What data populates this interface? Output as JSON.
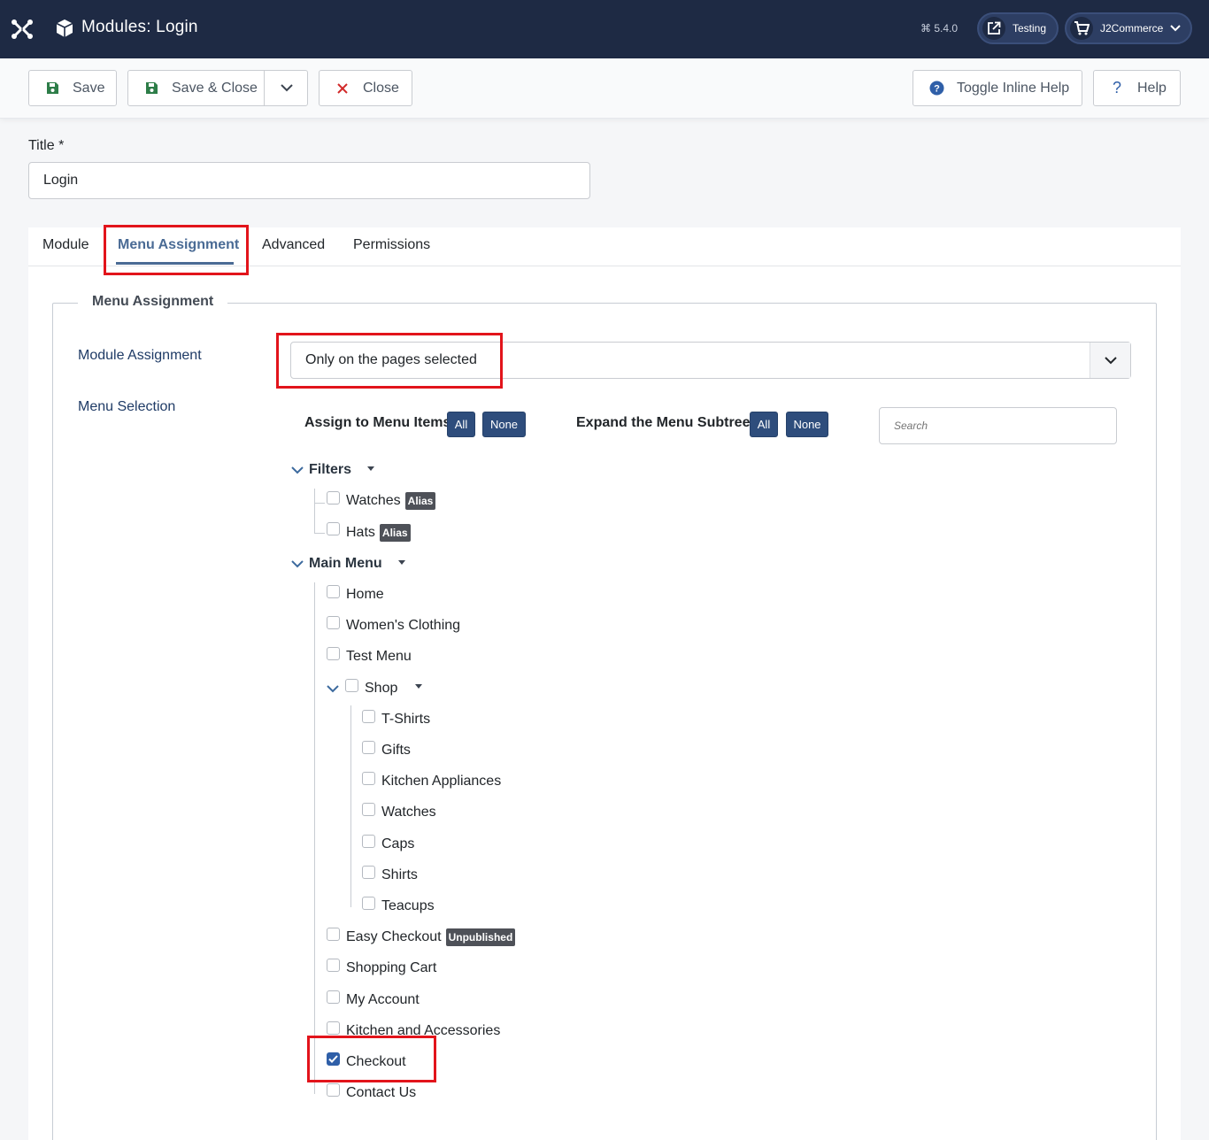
{
  "header": {
    "title": "Modules: Login",
    "version": "5.4.0",
    "site_button": "Testing",
    "user_button": "J2Commerce"
  },
  "toolbar": {
    "save": "Save",
    "save_close": "Save & Close",
    "close": "Close",
    "toggle_help": "Toggle Inline Help",
    "help": "Help"
  },
  "form": {
    "title_label": "Title *",
    "title_value": "Login"
  },
  "tabs": {
    "module": "Module",
    "menu_assignment": "Menu Assignment",
    "advanced": "Advanced",
    "permissions": "Permissions"
  },
  "menu_assignment": {
    "legend": "Menu Assignment",
    "module_assignment_label": "Module Assignment",
    "module_assignment_value": "Only on the pages selected",
    "menu_selection_label": "Menu Selection",
    "assign_label": "Assign to Menu Items",
    "expand_label": "Expand the Menu Subtrees",
    "all": "All",
    "none": "None",
    "search_placeholder": "Search"
  },
  "tree": {
    "filters": {
      "label": "Filters",
      "items": [
        {
          "label": "Watches",
          "badge": "Alias",
          "checked": false
        },
        {
          "label": "Hats",
          "badge": "Alias",
          "checked": false
        }
      ]
    },
    "main_menu": {
      "label": "Main Menu",
      "items": [
        {
          "label": "Home",
          "checked": false
        },
        {
          "label": "Women's Clothing",
          "checked": false
        },
        {
          "label": "Test Menu",
          "checked": false
        },
        {
          "label": "Shop",
          "checked": false
        },
        {
          "label": "Easy Checkout",
          "badge": "Unpublished",
          "checked": false
        },
        {
          "label": "Shopping Cart",
          "checked": false
        },
        {
          "label": "My Account",
          "checked": false
        },
        {
          "label": "Kitchen and Accessories",
          "checked": false
        },
        {
          "label": "Checkout",
          "checked": true
        },
        {
          "label": "Contact Us",
          "checked": false
        }
      ],
      "shop_children": [
        {
          "label": "T-Shirts",
          "checked": false
        },
        {
          "label": "Gifts",
          "checked": false
        },
        {
          "label": "Kitchen Appliances",
          "checked": false
        },
        {
          "label": "Watches",
          "checked": false
        },
        {
          "label": "Caps",
          "checked": false
        },
        {
          "label": "Shirts",
          "checked": false
        },
        {
          "label": "Teacups",
          "checked": false
        }
      ]
    }
  },
  "colors": {
    "header_bg": "#1e2a44",
    "primary": "#2e4d7c",
    "highlight": "#e2141b",
    "tab_active": "#4a6b95"
  }
}
